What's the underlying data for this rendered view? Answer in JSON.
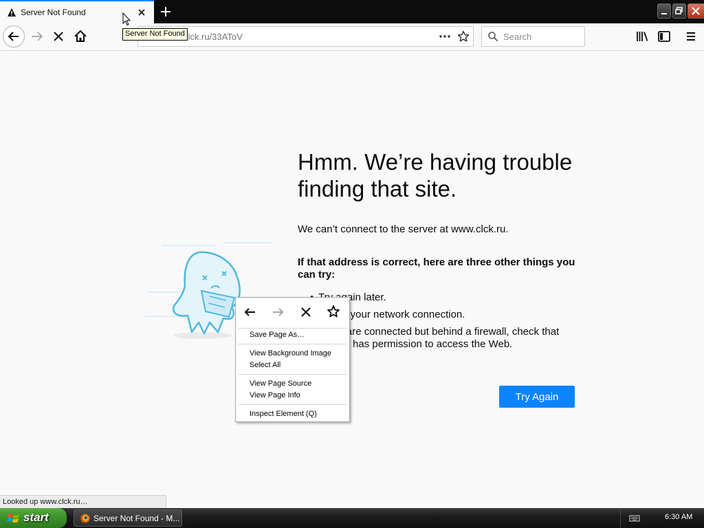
{
  "browser": {
    "tab": {
      "title": "Server Not Found"
    },
    "tooltip": "Server Not Found",
    "url": "clck.ru/33AToV",
    "search_placeholder": "Search"
  },
  "error_page": {
    "title": "Hmm. We’re having trouble finding that site.",
    "description": "We can’t connect to the server at www.clck.ru.",
    "heading": "If that address is correct, here are three other things you can try:",
    "suggestions": [
      "Try again later.",
      "Check your network connection.",
      "If you are connected but behind a firewall, check that Firefox has permission to access the Web."
    ],
    "try_again_label": "Try Again"
  },
  "context_menu": {
    "items": [
      "Save Page As…",
      "View Background Image",
      "Select All",
      "View Page Source",
      "View Page Info",
      "Inspect Element (Q)"
    ]
  },
  "status_line": "Looked up www.clck.ru…",
  "taskbar": {
    "start_label": "start",
    "task_label": "Server Not Found - M...",
    "clock": "6:30 AM"
  },
  "colors": {
    "accent": "#0a84ff",
    "tab_strip": "#0c0c0d",
    "page_bg": "#f9f9fa",
    "illustration": "#4fb8de"
  }
}
